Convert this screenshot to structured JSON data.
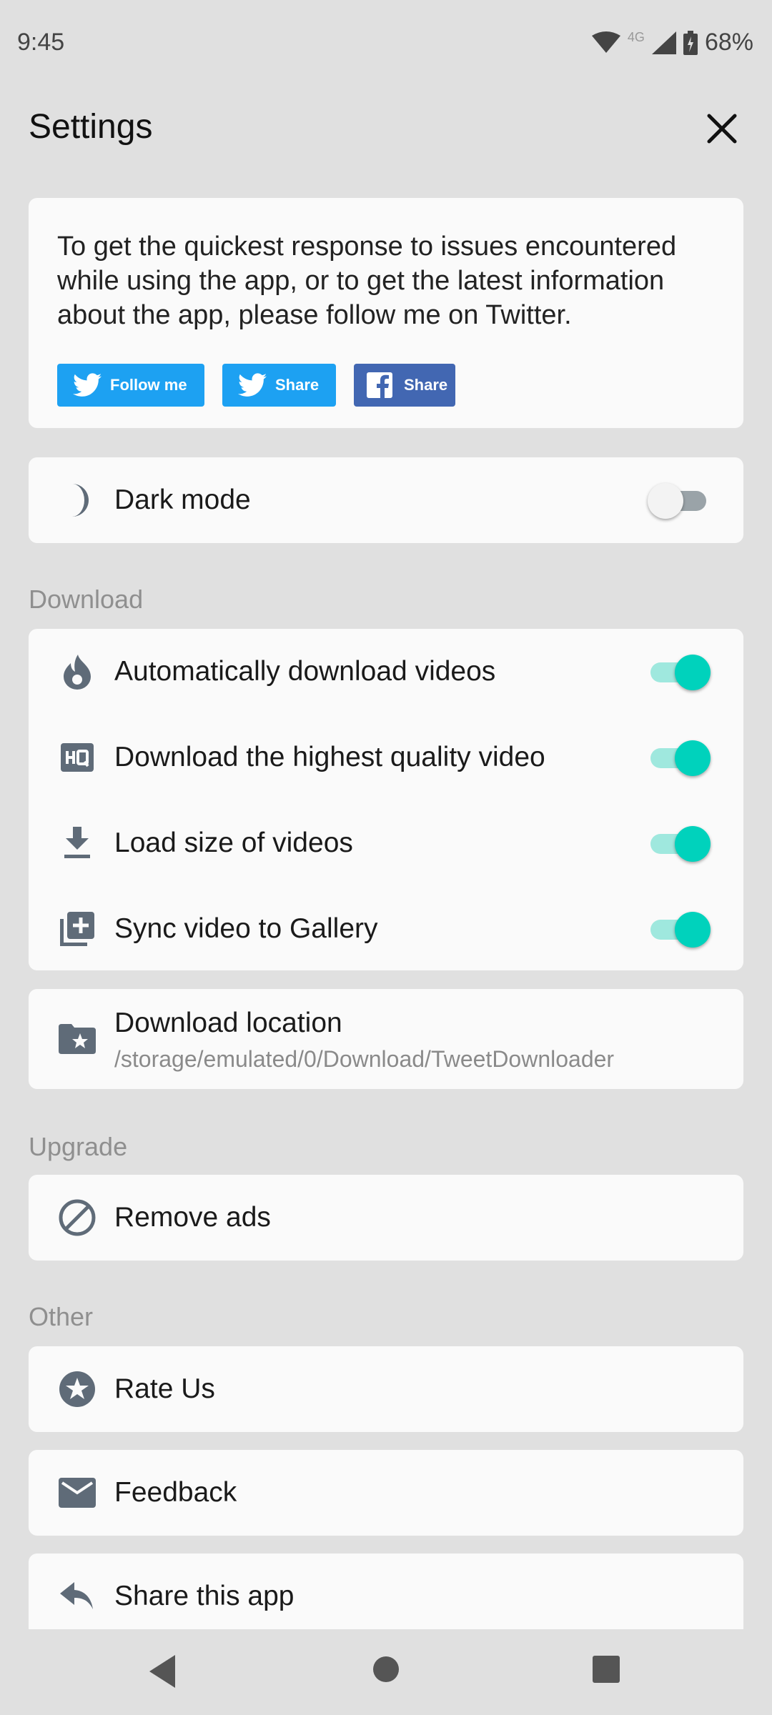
{
  "status_bar": {
    "time": "9:45",
    "network": "4G",
    "battery": "68%"
  },
  "header": {
    "title": "Settings"
  },
  "intro": {
    "text": "To get the quickest response to issues encountered while using the app, or to get the latest information about the app, please follow me on Twitter.",
    "follow_label": "Follow me",
    "twitter_share_label": "Share",
    "facebook_share_label": "Share"
  },
  "dark_mode": {
    "label": "Dark mode",
    "enabled": false
  },
  "download_section": {
    "title": "Download",
    "items": [
      {
        "label": "Automatically download videos",
        "icon": "flame-icon",
        "enabled": true
      },
      {
        "label": "Download the highest quality video",
        "icon": "hq-icon",
        "enabled": true
      },
      {
        "label": "Load size of videos",
        "icon": "download-icon",
        "enabled": true
      },
      {
        "label": "Sync video to Gallery",
        "icon": "add-to-library-icon",
        "enabled": true
      }
    ],
    "location_label": "Download location",
    "location_path": "/storage/emulated/0/Download/TweetDownloader"
  },
  "upgrade_section": {
    "title": "Upgrade",
    "remove_ads_label": "Remove ads"
  },
  "other_section": {
    "title": "Other",
    "rate_label": "Rate Us",
    "feedback_label": "Feedback",
    "share_label": "Share this app"
  },
  "colors": {
    "accent": "#00d2bc",
    "twitter": "#1da1f2",
    "facebook": "#4267b2",
    "icon": "#5f6b78"
  }
}
